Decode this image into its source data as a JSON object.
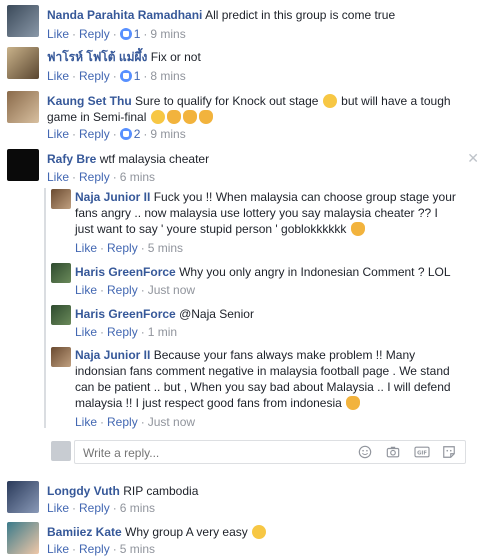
{
  "comments": [
    {
      "name": "Nanda Parahita Ramadhani",
      "text": "All predict in this group is come true",
      "like": "Like",
      "reply": "Reply",
      "count": "1",
      "time": "9 mins"
    },
    {
      "name": "ฟาโรห์ โฟโต้ แม่ผึ้ง",
      "text": "Fix or not",
      "like": "Like",
      "reply": "Reply",
      "count": "1",
      "time": "8 mins"
    },
    {
      "name": "Kaung Set Thu",
      "text1": "Sure to qualify for Knock out stage",
      "text2": "but will have a tough",
      "text3": "game in Semi-final",
      "like": "Like",
      "reply": "Reply",
      "count": "2",
      "time": "9 mins"
    },
    {
      "name": "Rafy Bre",
      "text": "wtf malaysia cheater",
      "like": "Like",
      "reply": "Reply",
      "time": "6 mins"
    }
  ],
  "replies": [
    {
      "name": "Naja Junior II",
      "line1": "Fuck you !! When malaysia can choose group stage your",
      "line2": "fans angry .. now malaysia use lottery you say malaysia cheater ?? I",
      "line3": "just want to say ' youre stupid person ' goblokkkkkk",
      "like": "Like",
      "reply": "Reply",
      "time": "5 mins"
    },
    {
      "name": "Haris GreenForce",
      "text": "Why you only angry in Indonesian Comment ? LOL",
      "like": "Like",
      "reply": "Reply",
      "time": "Just now"
    },
    {
      "name": "Haris GreenForce",
      "text": "@Naja Senior",
      "like": "Like",
      "reply": "Reply",
      "time": "1 min"
    },
    {
      "name": "Naja Junior II",
      "line1": "Because your fans always make problem !! Many",
      "line2": "indonsian fans comment negative in malaysia football page . We stand",
      "line3": "can be patient .. but , When you say bad about Malaysia .. I will defend",
      "line4": "malaysia !! I just respect good fans from indonesia",
      "like": "Like",
      "reply": "Reply",
      "time": "Just now"
    }
  ],
  "reply_input": {
    "placeholder": "Write a reply..."
  },
  "later_comments": [
    {
      "name": "Longdy Vuth",
      "text": "RIP cambodia",
      "like": "Like",
      "reply": "Reply",
      "time": "6 mins"
    },
    {
      "name": "Bamiiez Kate",
      "text": "Why group A very easy",
      "like": "Like",
      "reply": "Reply",
      "time": "5 mins"
    }
  ],
  "colors": {
    "link": "#4267b2",
    "name": "#365899",
    "meta": "#90949c"
  }
}
